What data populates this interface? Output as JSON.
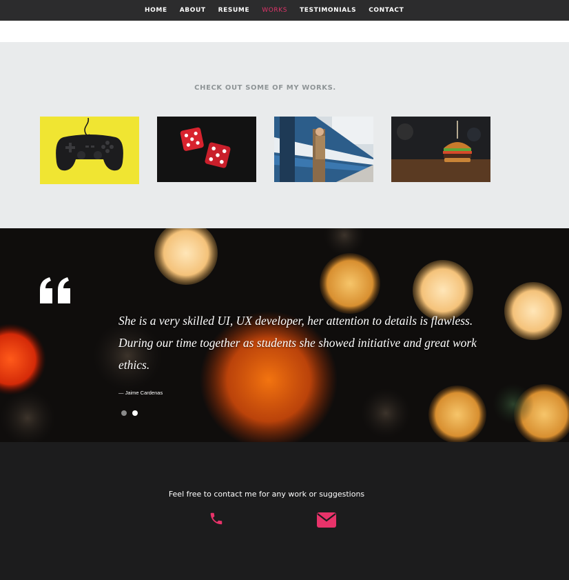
{
  "nav": {
    "items": [
      {
        "label": "HOME",
        "active": false
      },
      {
        "label": "ABOUT",
        "active": false
      },
      {
        "label": "RESUME",
        "active": false
      },
      {
        "label": "WORKS",
        "active": true
      },
      {
        "label": "TESTIMONIALS",
        "active": false
      },
      {
        "label": "CONTACT",
        "active": false
      }
    ]
  },
  "works": {
    "title": "CHECK OUT SOME OF MY WORKS.",
    "items": [
      {
        "subject": "game-controller"
      },
      {
        "subject": "red-dice"
      },
      {
        "subject": "man-at-train"
      },
      {
        "subject": "burger"
      }
    ]
  },
  "testimonial": {
    "quote": "She is a very skilled UI, UX developer, her attention to details is flawless. During our time together as students she showed initiative and great work ethics.",
    "author": "— Jaime Cardenas",
    "slides": 2,
    "active_slide": 2
  },
  "footer": {
    "contact_text": "Feel free to contact me for any work or suggestions",
    "phone_icon": "phone-icon",
    "email_icon": "envelope-icon"
  },
  "colors": {
    "accent": "#e0356b",
    "nav_bg": "#2c2c2d",
    "works_bg": "#e9ebec",
    "footer_bg": "#1c1c1d"
  }
}
